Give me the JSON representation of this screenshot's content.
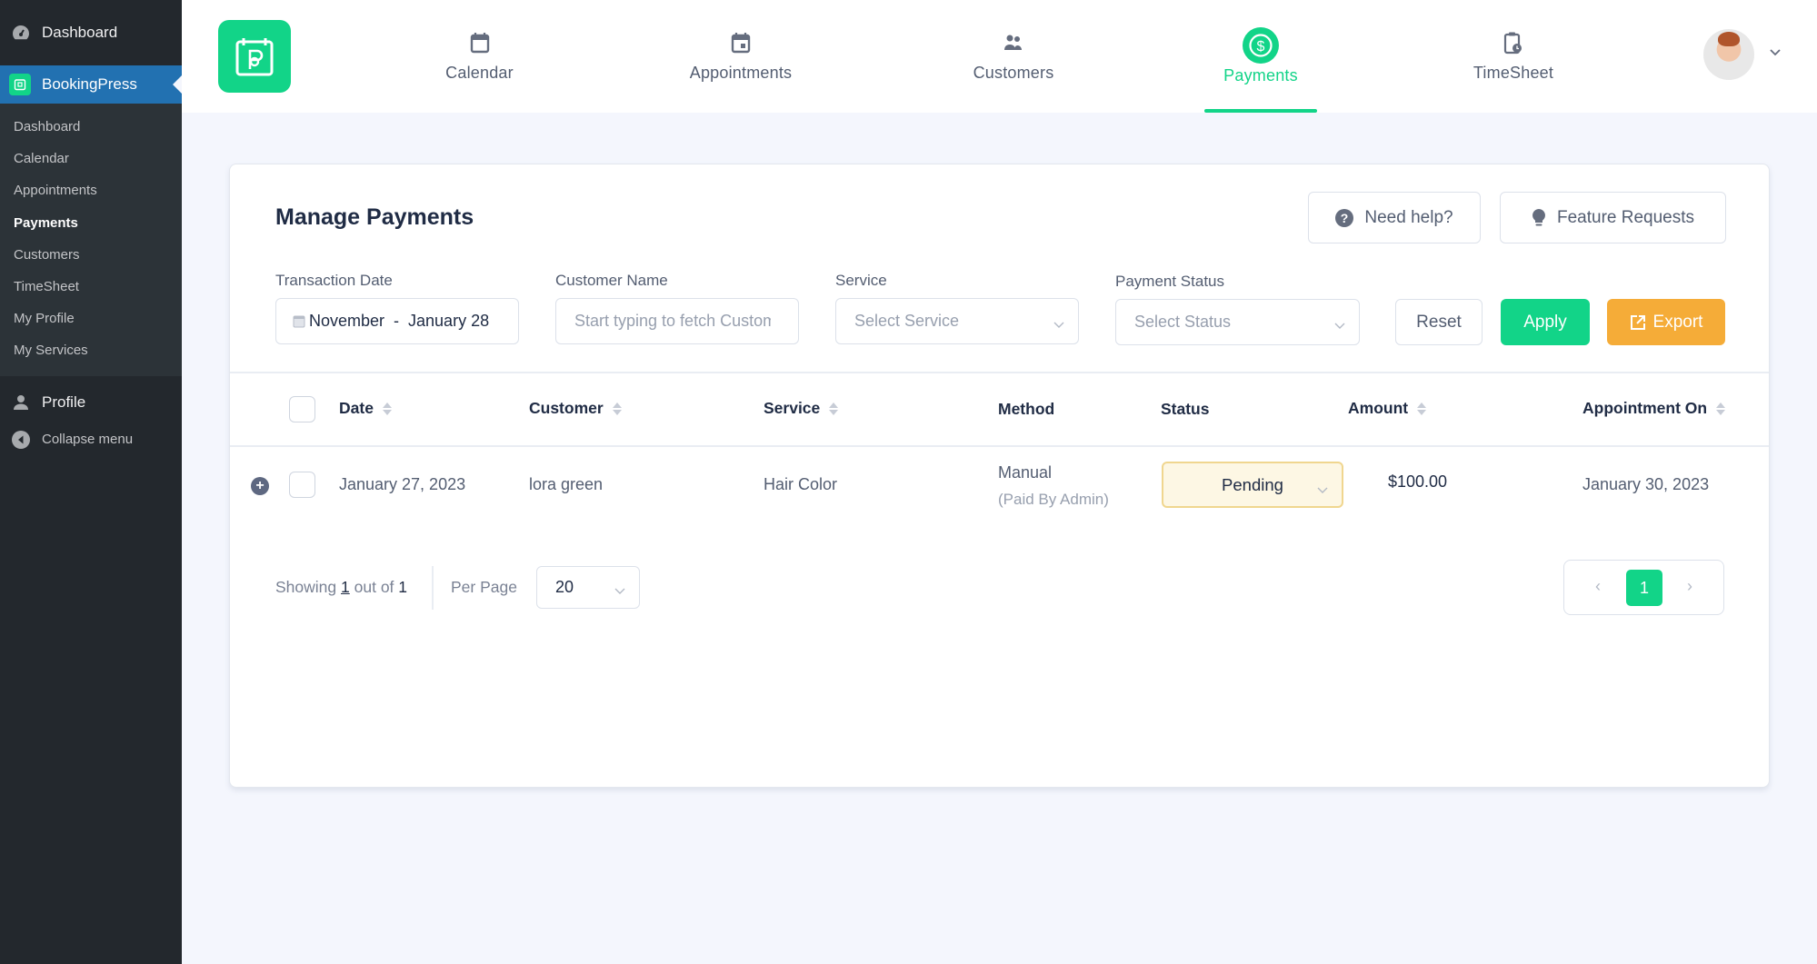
{
  "sidebar": {
    "top_item": "Dashboard",
    "active_plugin": "BookingPress",
    "submenu": [
      "Dashboard",
      "Calendar",
      "Appointments",
      "Payments",
      "Customers",
      "TimeSheet",
      "My Profile",
      "My Services"
    ],
    "current_submenu": "Payments",
    "profile": "Profile",
    "collapse": "Collapse menu"
  },
  "header": {
    "nav": [
      {
        "label": "Calendar",
        "icon": "calendar-icon"
      },
      {
        "label": "Appointments",
        "icon": "calendar-day-icon"
      },
      {
        "label": "Customers",
        "icon": "users-icon"
      },
      {
        "label": "Payments",
        "icon": "dollar-circle-icon",
        "active": true
      },
      {
        "label": "TimeSheet",
        "icon": "clipboard-clock-icon"
      }
    ]
  },
  "page": {
    "title": "Manage Payments",
    "need_help": "Need help?",
    "feature_requests": "Feature Requests"
  },
  "filters": {
    "transaction_date_label": "Transaction Date",
    "transaction_date_value": "November  -  January 28",
    "customer_name_label": "Customer Name",
    "customer_name_placeholder": "Start typing to fetch Customer",
    "service_label": "Service",
    "service_placeholder": "Select Service",
    "payment_status_label": "Payment Status",
    "payment_status_placeholder": "Select Status",
    "reset": "Reset",
    "apply": "Apply",
    "export": "Export"
  },
  "table": {
    "columns": [
      "Date",
      "Customer",
      "Service",
      "Method",
      "Status",
      "Amount",
      "Appointment On"
    ],
    "rows": [
      {
        "date": "January 27, 2023",
        "customer": "lora green",
        "service": "Hair Color",
        "method": "Manual",
        "method_note": "(Paid By Admin)",
        "status": "Pending",
        "amount": "$100.00",
        "appointment_on": "January 30, 2023"
      }
    ]
  },
  "pagination": {
    "showing_prefix": "Showing",
    "showing_count": "1",
    "showing_mid": "out of",
    "showing_total": "1",
    "per_page_label": "Per Page",
    "per_page_value": "20",
    "current_page": "1",
    "prev": "‹",
    "next": "›"
  },
  "colors": {
    "accent": "#12d488",
    "export": "#f5ac38",
    "wp_sidebar": "#23282d",
    "wp_active": "#2271b1",
    "pending_bg": "#fdf7e4"
  }
}
